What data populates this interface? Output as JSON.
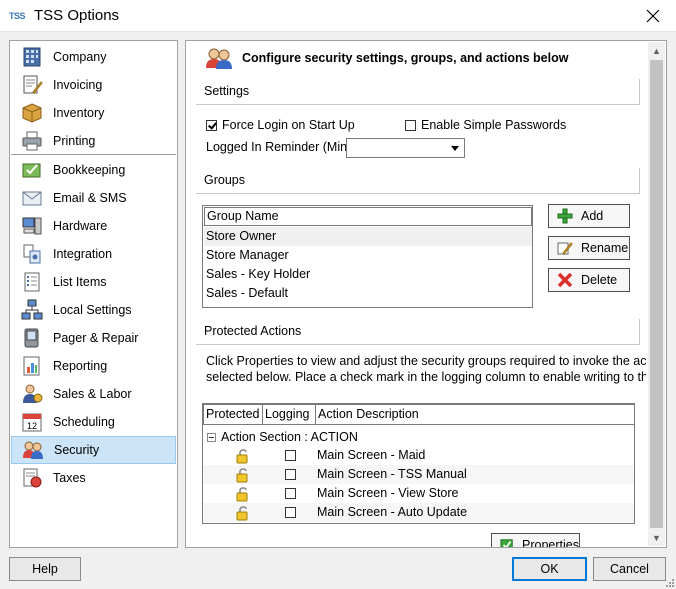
{
  "window": {
    "logo_text": "TSS",
    "title": "TSS Options"
  },
  "sidebar": {
    "items": [
      {
        "label": "Company",
        "icon": "building-icon"
      },
      {
        "label": "Invoicing",
        "icon": "invoice-pencil-icon"
      },
      {
        "label": "Inventory",
        "icon": "box-icon"
      },
      {
        "label": "Printing",
        "icon": "printer-icon"
      },
      {
        "label": "Bookkeeping",
        "icon": "check-book-icon"
      },
      {
        "label": "Email & SMS",
        "icon": "envelope-icon"
      },
      {
        "label": "Hardware",
        "icon": "computer-icon"
      },
      {
        "label": "Integration",
        "icon": "integration-icon"
      },
      {
        "label": "List Items",
        "icon": "list-icon"
      },
      {
        "label": "Local Settings",
        "icon": "network-icon"
      },
      {
        "label": "Pager & Repair",
        "icon": "pager-icon"
      },
      {
        "label": "Reporting",
        "icon": "report-chart-icon"
      },
      {
        "label": "Sales & Labor",
        "icon": "salesperson-icon"
      },
      {
        "label": "Scheduling",
        "icon": "calendar-icon"
      },
      {
        "label": "Security",
        "icon": "users-icon"
      },
      {
        "label": "Taxes",
        "icon": "taxes-icon"
      }
    ],
    "selected": "Security",
    "calendar_day": "12"
  },
  "main": {
    "heading": "Configure security settings, groups, and actions below",
    "settings": {
      "title": "Settings",
      "force_login_label": "Force Login on Start Up",
      "force_login_checked": true,
      "simple_passwords_label": "Enable Simple Passwords",
      "simple_passwords_checked": false,
      "reminder_label": "Logged In Reminder (Min)",
      "reminder_value": ""
    },
    "groups": {
      "title": "Groups",
      "column_header": "Group Name",
      "items": [
        "Store Owner",
        "Store Manager",
        "Sales - Key Holder",
        "Sales - Default"
      ],
      "selected_index": 0,
      "buttons": {
        "add": "Add",
        "rename": "Rename",
        "delete": "Delete"
      }
    },
    "protected_actions": {
      "title": "Protected Actions",
      "description_line1": "Click Properties to view and adjust the security groups required to invoke the actio",
      "description_line2": "selected below. Place a check mark in the logging column to enable writing to the",
      "columns": [
        "Protected",
        "Logging",
        "Action Description"
      ],
      "section_label": "Action Section : ACTION",
      "rows": [
        {
          "description": "Main Screen - Maid",
          "logging": false
        },
        {
          "description": "Main Screen - TSS Manual",
          "logging": false
        },
        {
          "description": "Main Screen - View Store",
          "logging": false
        },
        {
          "description": "Main Screen - Auto Update",
          "logging": false
        }
      ],
      "properties_button": "Properties"
    }
  },
  "footer": {
    "help": "Help",
    "ok": "OK",
    "cancel": "Cancel"
  },
  "colors": {
    "selection_bg": "#cce4f7",
    "selection_border": "#99c9ef",
    "accent": "#0078d7"
  }
}
